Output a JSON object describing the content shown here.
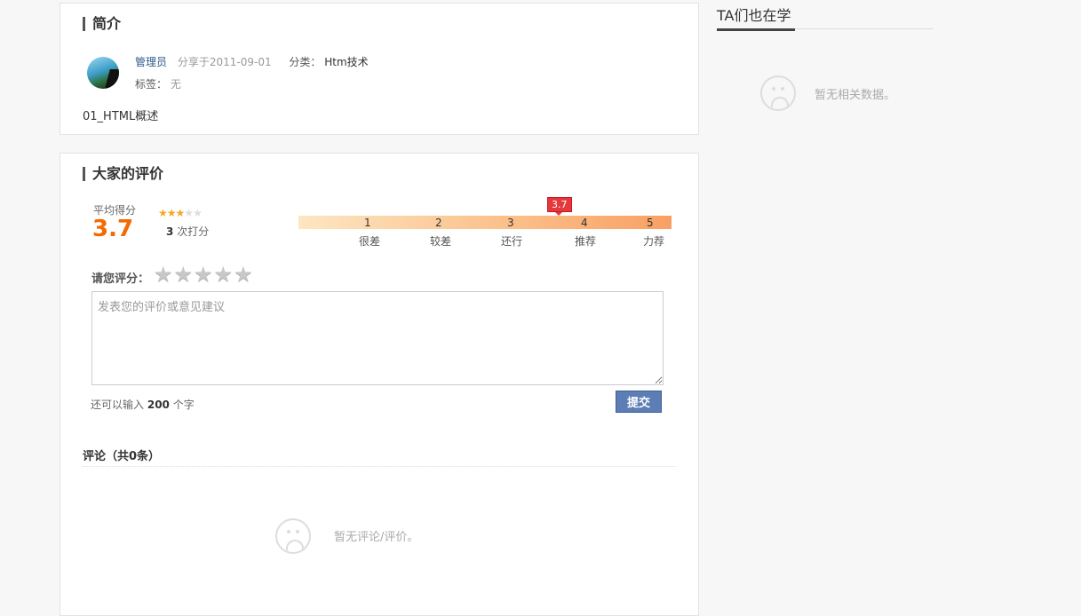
{
  "intro": {
    "title": "简介",
    "author": "管理员",
    "shared": "分享于2011-09-01",
    "category_label": "分类：",
    "category_value": "Htm技术",
    "tags_label": "标签：",
    "tags_value": "无",
    "description": "01_HTML概述"
  },
  "review": {
    "title": "大家的评价",
    "avg_label": "平均得分",
    "avg_score": "3.7",
    "mini_stars": {
      "filled": 3,
      "total": 5
    },
    "count_number": "3",
    "count_suffix": "次打分",
    "marker": "3.7",
    "scale": [
      {
        "num": "1",
        "word": "很差"
      },
      {
        "num": "2",
        "word": "较差"
      },
      {
        "num": "3",
        "word": "还行"
      },
      {
        "num": "4",
        "word": "推荐"
      },
      {
        "num": "5",
        "word": "力荐"
      }
    ],
    "rate_label": "请您评分：",
    "textarea_placeholder": "发表您的评价或意见建议",
    "remain_prefix": "还可以输入",
    "remain_number": "200",
    "remain_suffix": "个字",
    "submit_label": "提交"
  },
  "comments": {
    "title": "评论（共0条）",
    "empty": "暂无评论/评价。"
  },
  "sidebar": {
    "title": "TA们也在学",
    "empty": "暂无相关数据。"
  },
  "colors": {
    "accent": "#f56a00",
    "marker": "#e4393c",
    "submit": "#5c7eb5",
    "link": "#2c5a8a"
  }
}
